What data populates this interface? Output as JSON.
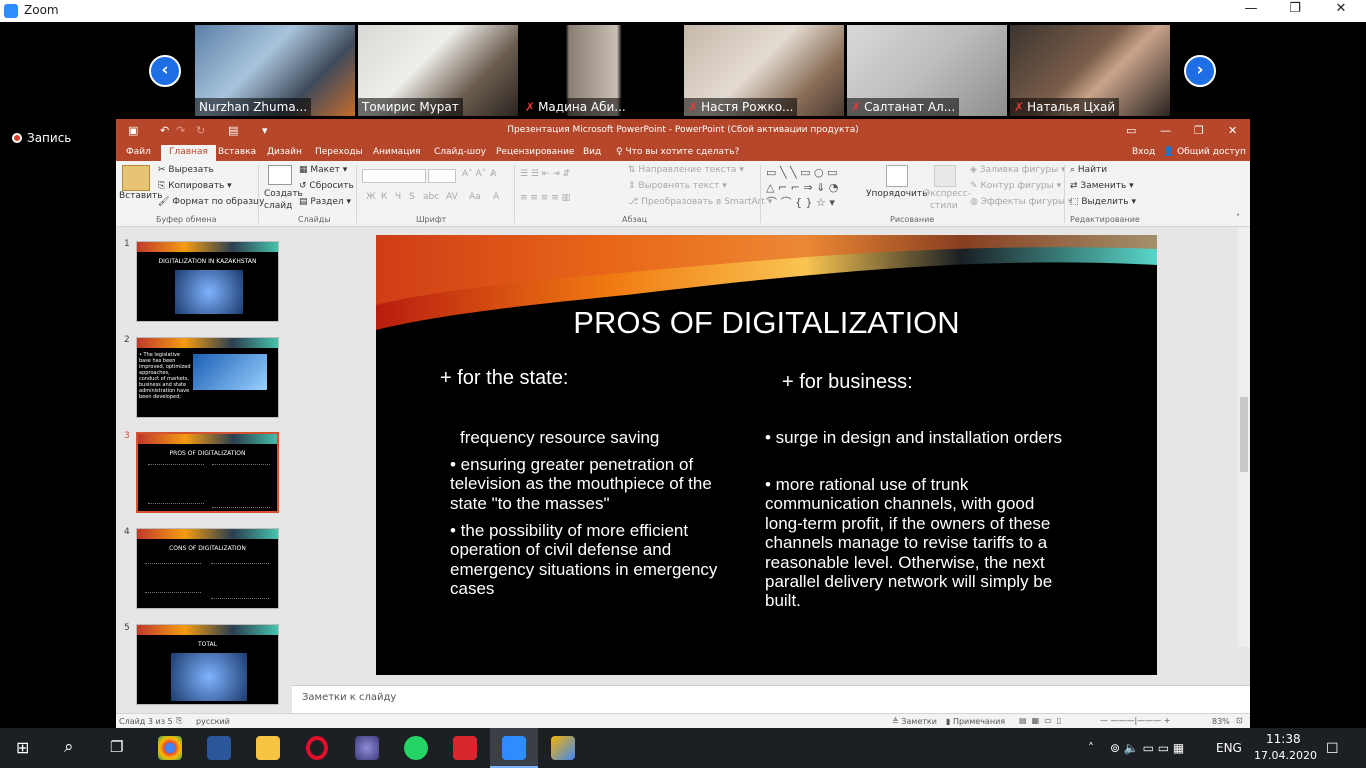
{
  "zoom": {
    "title": "Zoom"
  },
  "participants": [
    {
      "name": "Nurzhan Zhuma...",
      "muted": false
    },
    {
      "name": "Томирис Мурат",
      "muted": false
    },
    {
      "name": "Мадина Аби...",
      "muted": true
    },
    {
      "name": "Настя Рожко...",
      "muted": true
    },
    {
      "name": "Салтанат Ал...",
      "muted": true
    },
    {
      "name": "Наталья Цхай",
      "muted": true
    }
  ],
  "recording": {
    "label": "Запись"
  },
  "ppt": {
    "title": "Презентация Microsoft PowerPoint - PowerPoint (Сбой активации продукта)",
    "tabs": [
      "Файл",
      "Главная",
      "Вставка",
      "Дизайн",
      "Переходы",
      "Анимация",
      "Слайд-шоу",
      "Рецензирование",
      "Вид"
    ],
    "tell_me": "Что вы хотите сделать?",
    "login": "Вход",
    "share": "Общий доступ",
    "ribbon": {
      "paste": "Вставить",
      "cut": "Вырезать",
      "copy": "Копировать",
      "format_painter": "Формат по образцу",
      "clipboard": "Буфер обмена",
      "new_slide": "Создать",
      "new_slide2": "слайд",
      "layout": "Макет",
      "reset": "Сбросить",
      "section": "Раздел",
      "slides": "Слайды",
      "font": "Шрифт",
      "text_direction": "Направление текста",
      "align_text": "Выровнять текст",
      "smartart": "Преобразовать в SmartArt",
      "paragraph": "Абзац",
      "arrange": "Упорядочить",
      "quick_styles": "Экспресс-",
      "quick_styles2": "стили",
      "fill": "Заливка фигуры",
      "outline": "Контур фигуры",
      "effects": "Эффекты фигуры",
      "drawing": "Рисование",
      "find": "Найти",
      "replace": "Заменить",
      "select": "Выделить",
      "editing": "Редактирование",
      "font_btns": [
        "Ж",
        "К",
        "Ч",
        "S",
        "abc",
        "AV",
        "Aa",
        "A"
      ]
    },
    "thumbs": [
      {
        "num": "1",
        "title": "DIGITALIZATION IN KAZAKHSTAN"
      },
      {
        "num": "2",
        "title": "• The legislative base has been improved, optimized approaches, conduct of markets, business and state administration have been developed;"
      },
      {
        "num": "3",
        "title": "PROS OF DIGITALIZATION"
      },
      {
        "num": "4",
        "title": "CONS OF DIGITALIZATION"
      },
      {
        "num": "5",
        "title": "TOTAL"
      }
    ],
    "slide": {
      "title": "PROS OF DIGITALIZATION",
      "left_head": "+ for the state:",
      "left_items": [
        "frequency resource saving",
        "•  ensuring greater penetration of television as the mouthpiece of the state \"to the masses\"",
        "•  the possibility of more efficient operation of civil defense and emergency situations in emergency cases"
      ],
      "right_head": "+ for business:",
      "right_items": [
        "•  surge in design and installation orders",
        "• more rational use of trunk communication channels, with good long-term profit, if the owners of these channels manage to revise tariffs to a reasonable level. Otherwise, the next parallel delivery network will simply be built."
      ]
    },
    "notes": "Заметки к слайду",
    "status": {
      "slide": "Слайд 3 из 5",
      "lang": "русский",
      "notes": "Заметки",
      "comments": "Примечания",
      "zoom": "83%"
    }
  },
  "taskbar": {
    "lang": "ENG",
    "time": "11:38",
    "date": "17.04.2020"
  }
}
